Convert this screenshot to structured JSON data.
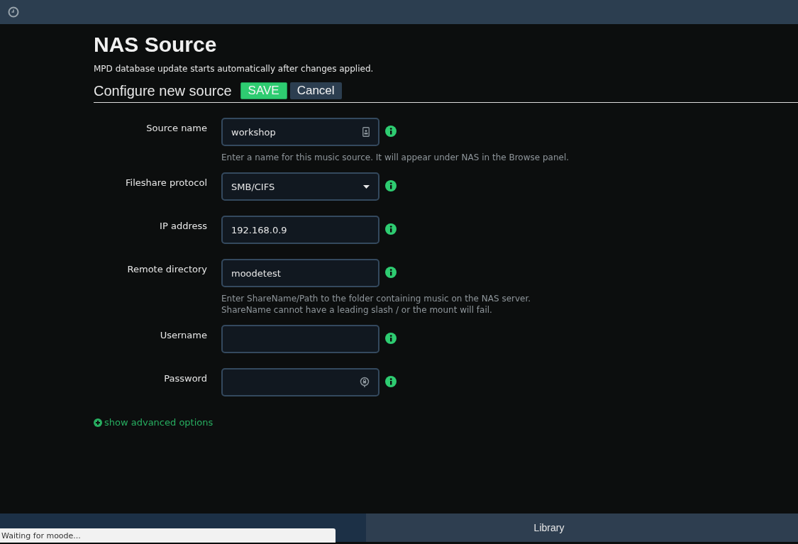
{
  "page": {
    "title": "NAS Source",
    "subtitle": "MPD database update starts automatically after changes applied."
  },
  "section": {
    "title": "Configure new source",
    "buttons": [
      {
        "label": "SAVE",
        "kind": "primary"
      },
      {
        "label": "Cancel",
        "kind": "secondary"
      }
    ]
  },
  "fields": [
    {
      "label": "Source name",
      "kind": "name",
      "value": "workshop",
      "help": [
        "Enter a name for this music source. It will appear under NAS in the Browse panel."
      ]
    },
    {
      "label": "Fileshare protocol",
      "kind": "select",
      "value": "SMB/CIFS"
    },
    {
      "label": "IP address",
      "kind": "text",
      "value": "192.168.0.9"
    },
    {
      "label": "Remote directory",
      "kind": "text",
      "value": "moodetest",
      "help": [
        "Enter ShareName/Path to the folder containing music on the NAS server.",
        "ShareName cannot have a leading slash / or the mount will fail."
      ]
    },
    {
      "label": "Username",
      "kind": "text"
    },
    {
      "label": "Password",
      "kind": "password"
    }
  ],
  "advanced_link": "show advanced options",
  "tabs": [
    {
      "selected": true
    },
    {
      "label": "Library",
      "selected": false
    }
  ],
  "status_tooltip": "Waiting for moode..."
}
